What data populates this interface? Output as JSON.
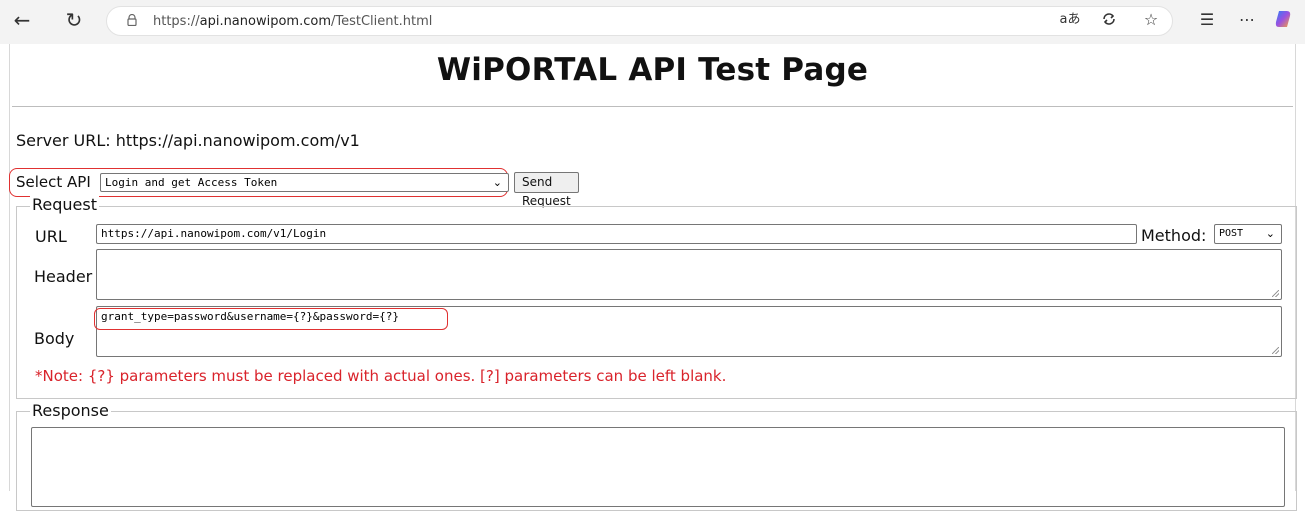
{
  "browser": {
    "url_prefix": "https://",
    "url_host": "api.nanowipom.com",
    "url_path": "/TestClient.html",
    "read_aloud_glyph": "aあ"
  },
  "page": {
    "title": "WiPORTAL API Test Page",
    "server_url_text": "Server URL: https://api.nanowipom.com/v1",
    "select_api_label": "Select API",
    "select_api_value": "Login and get Access Token",
    "send_request_label": "Send Request",
    "request": {
      "legend": "Request",
      "url_label": "URL",
      "url_value": "https://api.nanowipom.com/v1/Login",
      "method_label": "Method:",
      "method_value": "POST",
      "header_label": "Header",
      "header_value": "",
      "body_label": "Body",
      "body_value": "grant_type=password&username={?}&password={?}",
      "note": "*Note: {?} parameters must be replaced with actual ones. [?] parameters can be left blank."
    },
    "response": {
      "legend": "Response",
      "value": ""
    }
  },
  "colors": {
    "highlight": "#e03131",
    "note": "#d9232b"
  }
}
